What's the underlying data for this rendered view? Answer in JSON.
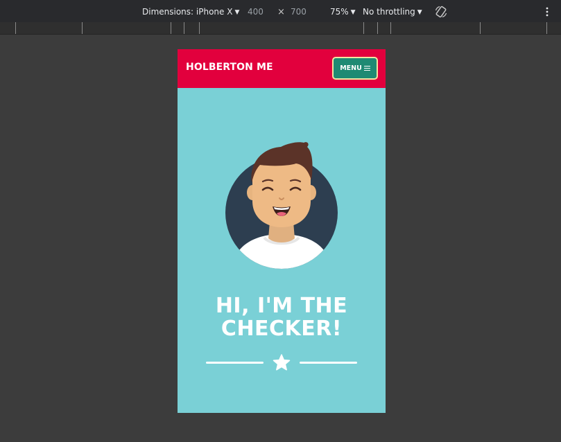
{
  "toolbar": {
    "dimensions_label": "Dimensions: iPhone X",
    "width_value": "400",
    "times_sign": "×",
    "height_value": "700",
    "zoom": "75%",
    "throttling": "No throttling"
  },
  "site": {
    "brand": "HOLBERTON ME",
    "menu_label": "MENU",
    "hero_title": "HI, I'M THE CHECKER!"
  },
  "colors": {
    "header": "#e2003d",
    "menu_button": "#1f8a73",
    "menu_border": "#f2e6a1",
    "page_bg": "#7ad0d6",
    "avatar_circle": "#2d3e50"
  },
  "icons": [
    "chevron-down-icon",
    "rotate-icon",
    "more-vert-icon",
    "menu-icon",
    "star-icon"
  ]
}
